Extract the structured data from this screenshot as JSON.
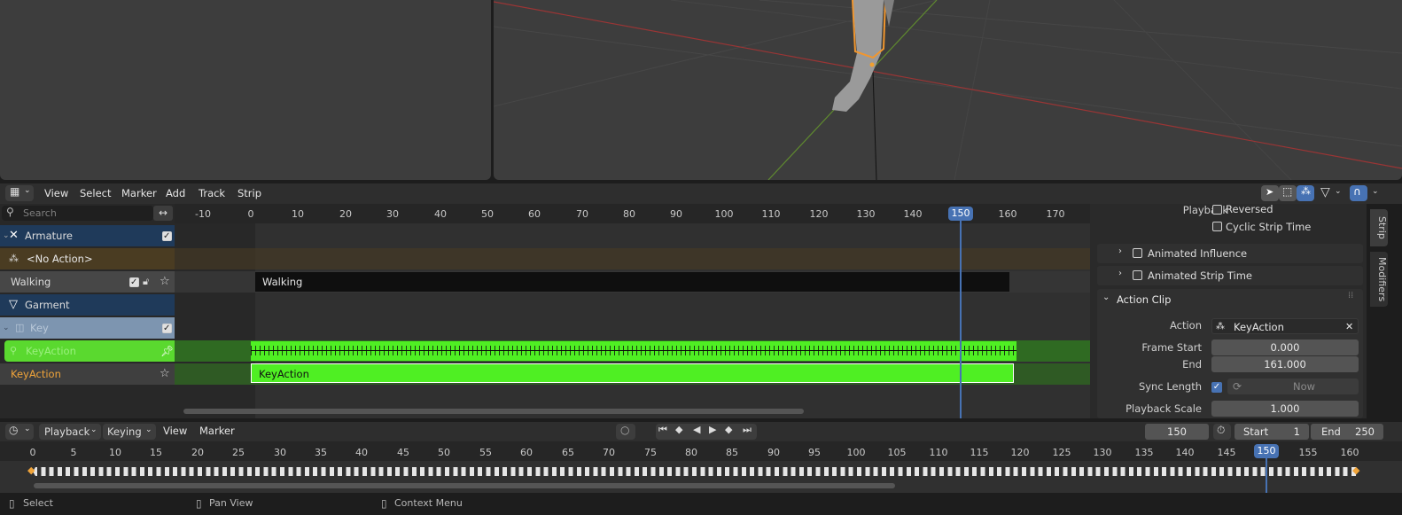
{
  "nla_header": {
    "menus": [
      "View",
      "Select",
      "Marker",
      "Add",
      "Track",
      "Strip"
    ]
  },
  "channels": {
    "search_placeholder": "Search",
    "items": [
      {
        "label": "Armature"
      },
      {
        "label": "<No Action>"
      },
      {
        "label": "Walking"
      },
      {
        "label": "Garment"
      },
      {
        "label": "Key"
      },
      {
        "label": "KeyAction"
      },
      {
        "label": "KeyAction"
      }
    ]
  },
  "nla_ruler": {
    "ticks": [
      "-10",
      "0",
      "10",
      "20",
      "30",
      "40",
      "50",
      "60",
      "70",
      "80",
      "90",
      "100",
      "110",
      "120",
      "130",
      "140",
      "150",
      "160",
      "170"
    ],
    "current_frame": "150"
  },
  "strips": {
    "walking": "Walking",
    "keyaction": "KeyAction"
  },
  "sidebar": {
    "playback_label": "Playback",
    "reversed": "Reversed",
    "cyclic": "Cyclic Strip Time",
    "animated_influence": "Animated Influence",
    "animated_strip_time": "Animated Strip Time",
    "action_clip": "Action Clip",
    "action_label": "Action",
    "action_value": "KeyAction",
    "frame_start_label": "Frame Start",
    "frame_start_value": "0.000",
    "end_label": "End",
    "end_value": "161.000",
    "sync_length_label": "Sync Length",
    "now_button": "Now",
    "playback_scale_label": "Playback Scale",
    "playback_scale_value": "1.000",
    "tabs": [
      "Strip",
      "Modifiers"
    ]
  },
  "timeline_header": {
    "playback": "Playback",
    "keying": "Keying",
    "view": "View",
    "marker": "Marker",
    "current_frame": "150",
    "start_label": "Start",
    "start_value": "1",
    "end_label": "End",
    "end_value": "250"
  },
  "timeline": {
    "ticks": [
      "0",
      "5",
      "10",
      "15",
      "20",
      "25",
      "30",
      "35",
      "40",
      "45",
      "50",
      "55",
      "60",
      "65",
      "70",
      "75",
      "80",
      "85",
      "90",
      "95",
      "100",
      "105",
      "110",
      "115",
      "120",
      "125",
      "130",
      "135",
      "140",
      "145",
      "150",
      "155",
      "160"
    ],
    "current_frame": "150"
  },
  "status": {
    "select": "Select",
    "pan_view": "Pan View",
    "context_menu": "Context Menu"
  },
  "colors": {
    "accent": "#4772b3",
    "strip_green": "#4fef23",
    "selected_channel": "#5ad92f"
  }
}
